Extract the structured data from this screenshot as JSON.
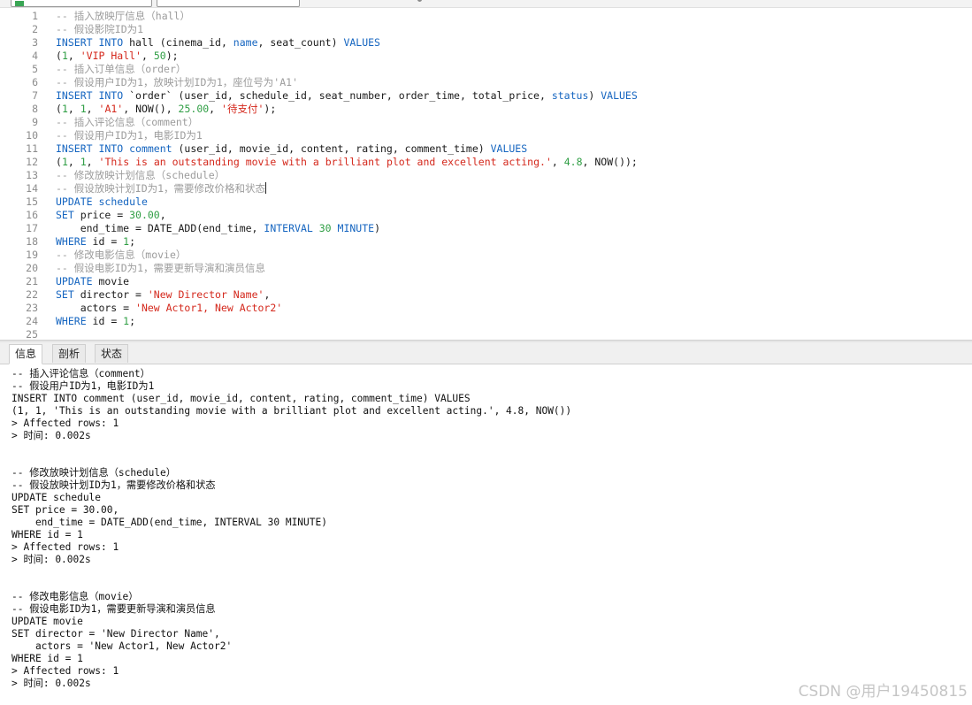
{
  "editor": {
    "lines": [
      {
        "n": "1",
        "tokens": [
          {
            "t": "cm",
            "v": "-- 插入放映厅信息（hall）"
          }
        ]
      },
      {
        "n": "2",
        "tokens": [
          {
            "t": "cm",
            "v": "-- 假设影院ID为1"
          }
        ]
      },
      {
        "n": "3",
        "tokens": [
          {
            "t": "kw",
            "v": "INSERT INTO"
          },
          {
            "t": "def",
            "v": " hall (cinema_id, "
          },
          {
            "t": "kw",
            "v": "name"
          },
          {
            "t": "def",
            "v": ", seat_count) "
          },
          {
            "t": "kw",
            "v": "VALUES"
          }
        ]
      },
      {
        "n": "4",
        "tokens": [
          {
            "t": "def",
            "v": "("
          },
          {
            "t": "num",
            "v": "1"
          },
          {
            "t": "def",
            "v": ", "
          },
          {
            "t": "str",
            "v": "'VIP Hall'"
          },
          {
            "t": "def",
            "v": ", "
          },
          {
            "t": "num",
            "v": "50"
          },
          {
            "t": "def",
            "v": ");"
          }
        ]
      },
      {
        "n": "5",
        "tokens": [
          {
            "t": "cm",
            "v": "-- 插入订单信息（order）"
          }
        ]
      },
      {
        "n": "6",
        "tokens": [
          {
            "t": "cm",
            "v": "-- 假设用户ID为1，放映计划ID为1，座位号为'A1'"
          }
        ]
      },
      {
        "n": "7",
        "tokens": [
          {
            "t": "kw",
            "v": "INSERT INTO"
          },
          {
            "t": "def",
            "v": " `order` (user_id, schedule_id, seat_number, order_time, total_price, "
          },
          {
            "t": "kw",
            "v": "status"
          },
          {
            "t": "def",
            "v": ") "
          },
          {
            "t": "kw",
            "v": "VALUES"
          }
        ]
      },
      {
        "n": "8",
        "tokens": [
          {
            "t": "def",
            "v": "("
          },
          {
            "t": "num",
            "v": "1"
          },
          {
            "t": "def",
            "v": ", "
          },
          {
            "t": "num",
            "v": "1"
          },
          {
            "t": "def",
            "v": ", "
          },
          {
            "t": "str",
            "v": "'A1'"
          },
          {
            "t": "def",
            "v": ", NOW(), "
          },
          {
            "t": "num",
            "v": "25.00"
          },
          {
            "t": "def",
            "v": ", "
          },
          {
            "t": "str",
            "v": "'待支付'"
          },
          {
            "t": "def",
            "v": ");"
          }
        ]
      },
      {
        "n": "9",
        "tokens": [
          {
            "t": "cm",
            "v": "-- 插入评论信息（comment）"
          }
        ]
      },
      {
        "n": "10",
        "tokens": [
          {
            "t": "cm",
            "v": "-- 假设用户ID为1，电影ID为1"
          }
        ]
      },
      {
        "n": "11",
        "tokens": [
          {
            "t": "kw",
            "v": "INSERT INTO"
          },
          {
            "t": "def",
            "v": " "
          },
          {
            "t": "kw",
            "v": "comment"
          },
          {
            "t": "def",
            "v": " (user_id, movie_id, content, rating, comment_time) "
          },
          {
            "t": "kw",
            "v": "VALUES"
          }
        ]
      },
      {
        "n": "12",
        "tokens": [
          {
            "t": "def",
            "v": "("
          },
          {
            "t": "num",
            "v": "1"
          },
          {
            "t": "def",
            "v": ", "
          },
          {
            "t": "num",
            "v": "1"
          },
          {
            "t": "def",
            "v": ", "
          },
          {
            "t": "str",
            "v": "'This is an outstanding movie with a brilliant plot and excellent acting.'"
          },
          {
            "t": "def",
            "v": ", "
          },
          {
            "t": "num",
            "v": "4.8"
          },
          {
            "t": "def",
            "v": ", NOW());"
          }
        ]
      },
      {
        "n": "13",
        "tokens": [
          {
            "t": "cm",
            "v": "-- 修改放映计划信息（schedule）"
          }
        ]
      },
      {
        "n": "14",
        "tokens": [
          {
            "t": "cm",
            "v": "-- 假设放映计划ID为1，需要修改价格和状态"
          }
        ],
        "caret": true
      },
      {
        "n": "15",
        "tokens": [
          {
            "t": "kw",
            "v": "UPDATE"
          },
          {
            "t": "def",
            "v": " "
          },
          {
            "t": "kw",
            "v": "schedule"
          }
        ]
      },
      {
        "n": "16",
        "tokens": [
          {
            "t": "kw",
            "v": "SET"
          },
          {
            "t": "def",
            "v": " price = "
          },
          {
            "t": "num",
            "v": "30.00"
          },
          {
            "t": "def",
            "v": ","
          }
        ]
      },
      {
        "n": "17",
        "tokens": [
          {
            "t": "def",
            "v": "    end_time = DATE_ADD(end_time, "
          },
          {
            "t": "kw",
            "v": "INTERVAL"
          },
          {
            "t": "def",
            "v": " "
          },
          {
            "t": "num",
            "v": "30"
          },
          {
            "t": "def",
            "v": " "
          },
          {
            "t": "kw",
            "v": "MINUTE"
          },
          {
            "t": "def",
            "v": ")"
          }
        ]
      },
      {
        "n": "18",
        "tokens": [
          {
            "t": "kw",
            "v": "WHERE"
          },
          {
            "t": "def",
            "v": " id = "
          },
          {
            "t": "num",
            "v": "1"
          },
          {
            "t": "def",
            "v": ";"
          }
        ]
      },
      {
        "n": "19",
        "tokens": [
          {
            "t": "cm",
            "v": "-- 修改电影信息（movie）"
          }
        ]
      },
      {
        "n": "20",
        "tokens": [
          {
            "t": "cm",
            "v": "-- 假设电影ID为1，需要更新导演和演员信息"
          }
        ]
      },
      {
        "n": "21",
        "tokens": [
          {
            "t": "kw",
            "v": "UPDATE"
          },
          {
            "t": "def",
            "v": " movie"
          }
        ]
      },
      {
        "n": "22",
        "tokens": [
          {
            "t": "kw",
            "v": "SET"
          },
          {
            "t": "def",
            "v": " director = "
          },
          {
            "t": "str",
            "v": "'New Director Name'"
          },
          {
            "t": "def",
            "v": ","
          }
        ]
      },
      {
        "n": "23",
        "tokens": [
          {
            "t": "def",
            "v": "    actors = "
          },
          {
            "t": "str",
            "v": "'New Actor1, New Actor2'"
          }
        ]
      },
      {
        "n": "24",
        "tokens": [
          {
            "t": "kw",
            "v": "WHERE"
          },
          {
            "t": "def",
            "v": " id = "
          },
          {
            "t": "num",
            "v": "1"
          },
          {
            "t": "def",
            "v": ";"
          }
        ]
      },
      {
        "n": "25",
        "tokens": []
      }
    ]
  },
  "tabs": [
    {
      "label": "信息",
      "active": true
    },
    {
      "label": "剖析",
      "active": false
    },
    {
      "label": "状态",
      "active": false
    }
  ],
  "output": {
    "lines": [
      "-- 插入评论信息（comment）",
      "-- 假设用户ID为1，电影ID为1",
      "INSERT INTO comment (user_id, movie_id, content, rating, comment_time) VALUES",
      "(1, 1, 'This is an outstanding movie with a brilliant plot and excellent acting.', 4.8, NOW())",
      "> Affected rows: 1",
      "> 时间: 0.002s",
      "",
      "",
      "-- 修改放映计划信息（schedule）",
      "-- 假设放映计划ID为1，需要修改价格和状态",
      "UPDATE schedule",
      "SET price = 30.00,",
      "    end_time = DATE_ADD(end_time, INTERVAL 30 MINUTE)",
      "WHERE id = 1",
      "> Affected rows: 1",
      "> 时间: 0.002s",
      "",
      "",
      "-- 修改电影信息（movie）",
      "-- 假设电影ID为1，需要更新导演和演员信息",
      "UPDATE movie",
      "SET director = 'New Director Name',",
      "    actors = 'New Actor1, New Actor2'",
      "WHERE id = 1",
      "> Affected rows: 1",
      "> 时间: 0.002s"
    ]
  },
  "watermark": "CSDN @用户19450815",
  "colors": {
    "keyword": "#1565c0",
    "comment": "#9c9c9c",
    "string": "#d4281c",
    "number": "#2f9e44",
    "default": "#1a1a1a"
  }
}
